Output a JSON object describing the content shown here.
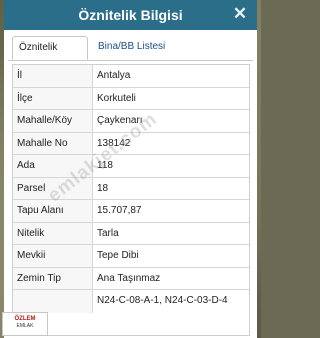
{
  "window": {
    "title": "Öznitelik Bilgisi"
  },
  "tabs": [
    {
      "label": "Öznitelik Bilgisi",
      "active": true
    },
    {
      "label": "Bina/BB Listesi",
      "active": false
    }
  ],
  "rows": [
    {
      "key": "İl",
      "value": "Antalya"
    },
    {
      "key": "İlçe",
      "value": "Korkuteli"
    },
    {
      "key": "Mahalle/Köy",
      "value": "Çaykenarı"
    },
    {
      "key": "Mahalle No",
      "value": "138142"
    },
    {
      "key": "Ada",
      "value": "118"
    },
    {
      "key": "Parsel",
      "value": "18"
    },
    {
      "key": "Tapu Alanı",
      "value": "15.707,87"
    },
    {
      "key": "Nitelik",
      "value": "Tarla"
    },
    {
      "key": "Mevkii",
      "value": "Tepe Dibi"
    },
    {
      "key": "Zemin Tip",
      "value": "Ana Taşınmaz"
    },
    {
      "key": "",
      "value": "N24-C-08-A-1, N24-C-03-D-4"
    }
  ],
  "watermark": {
    "text": "emlakjet.com"
  },
  "logo": {
    "text": "ÖZLEM",
    "subtext": "EMLAK"
  },
  "colors": {
    "titlebar": "#2b6e8a",
    "link": "#1d4f86"
  }
}
